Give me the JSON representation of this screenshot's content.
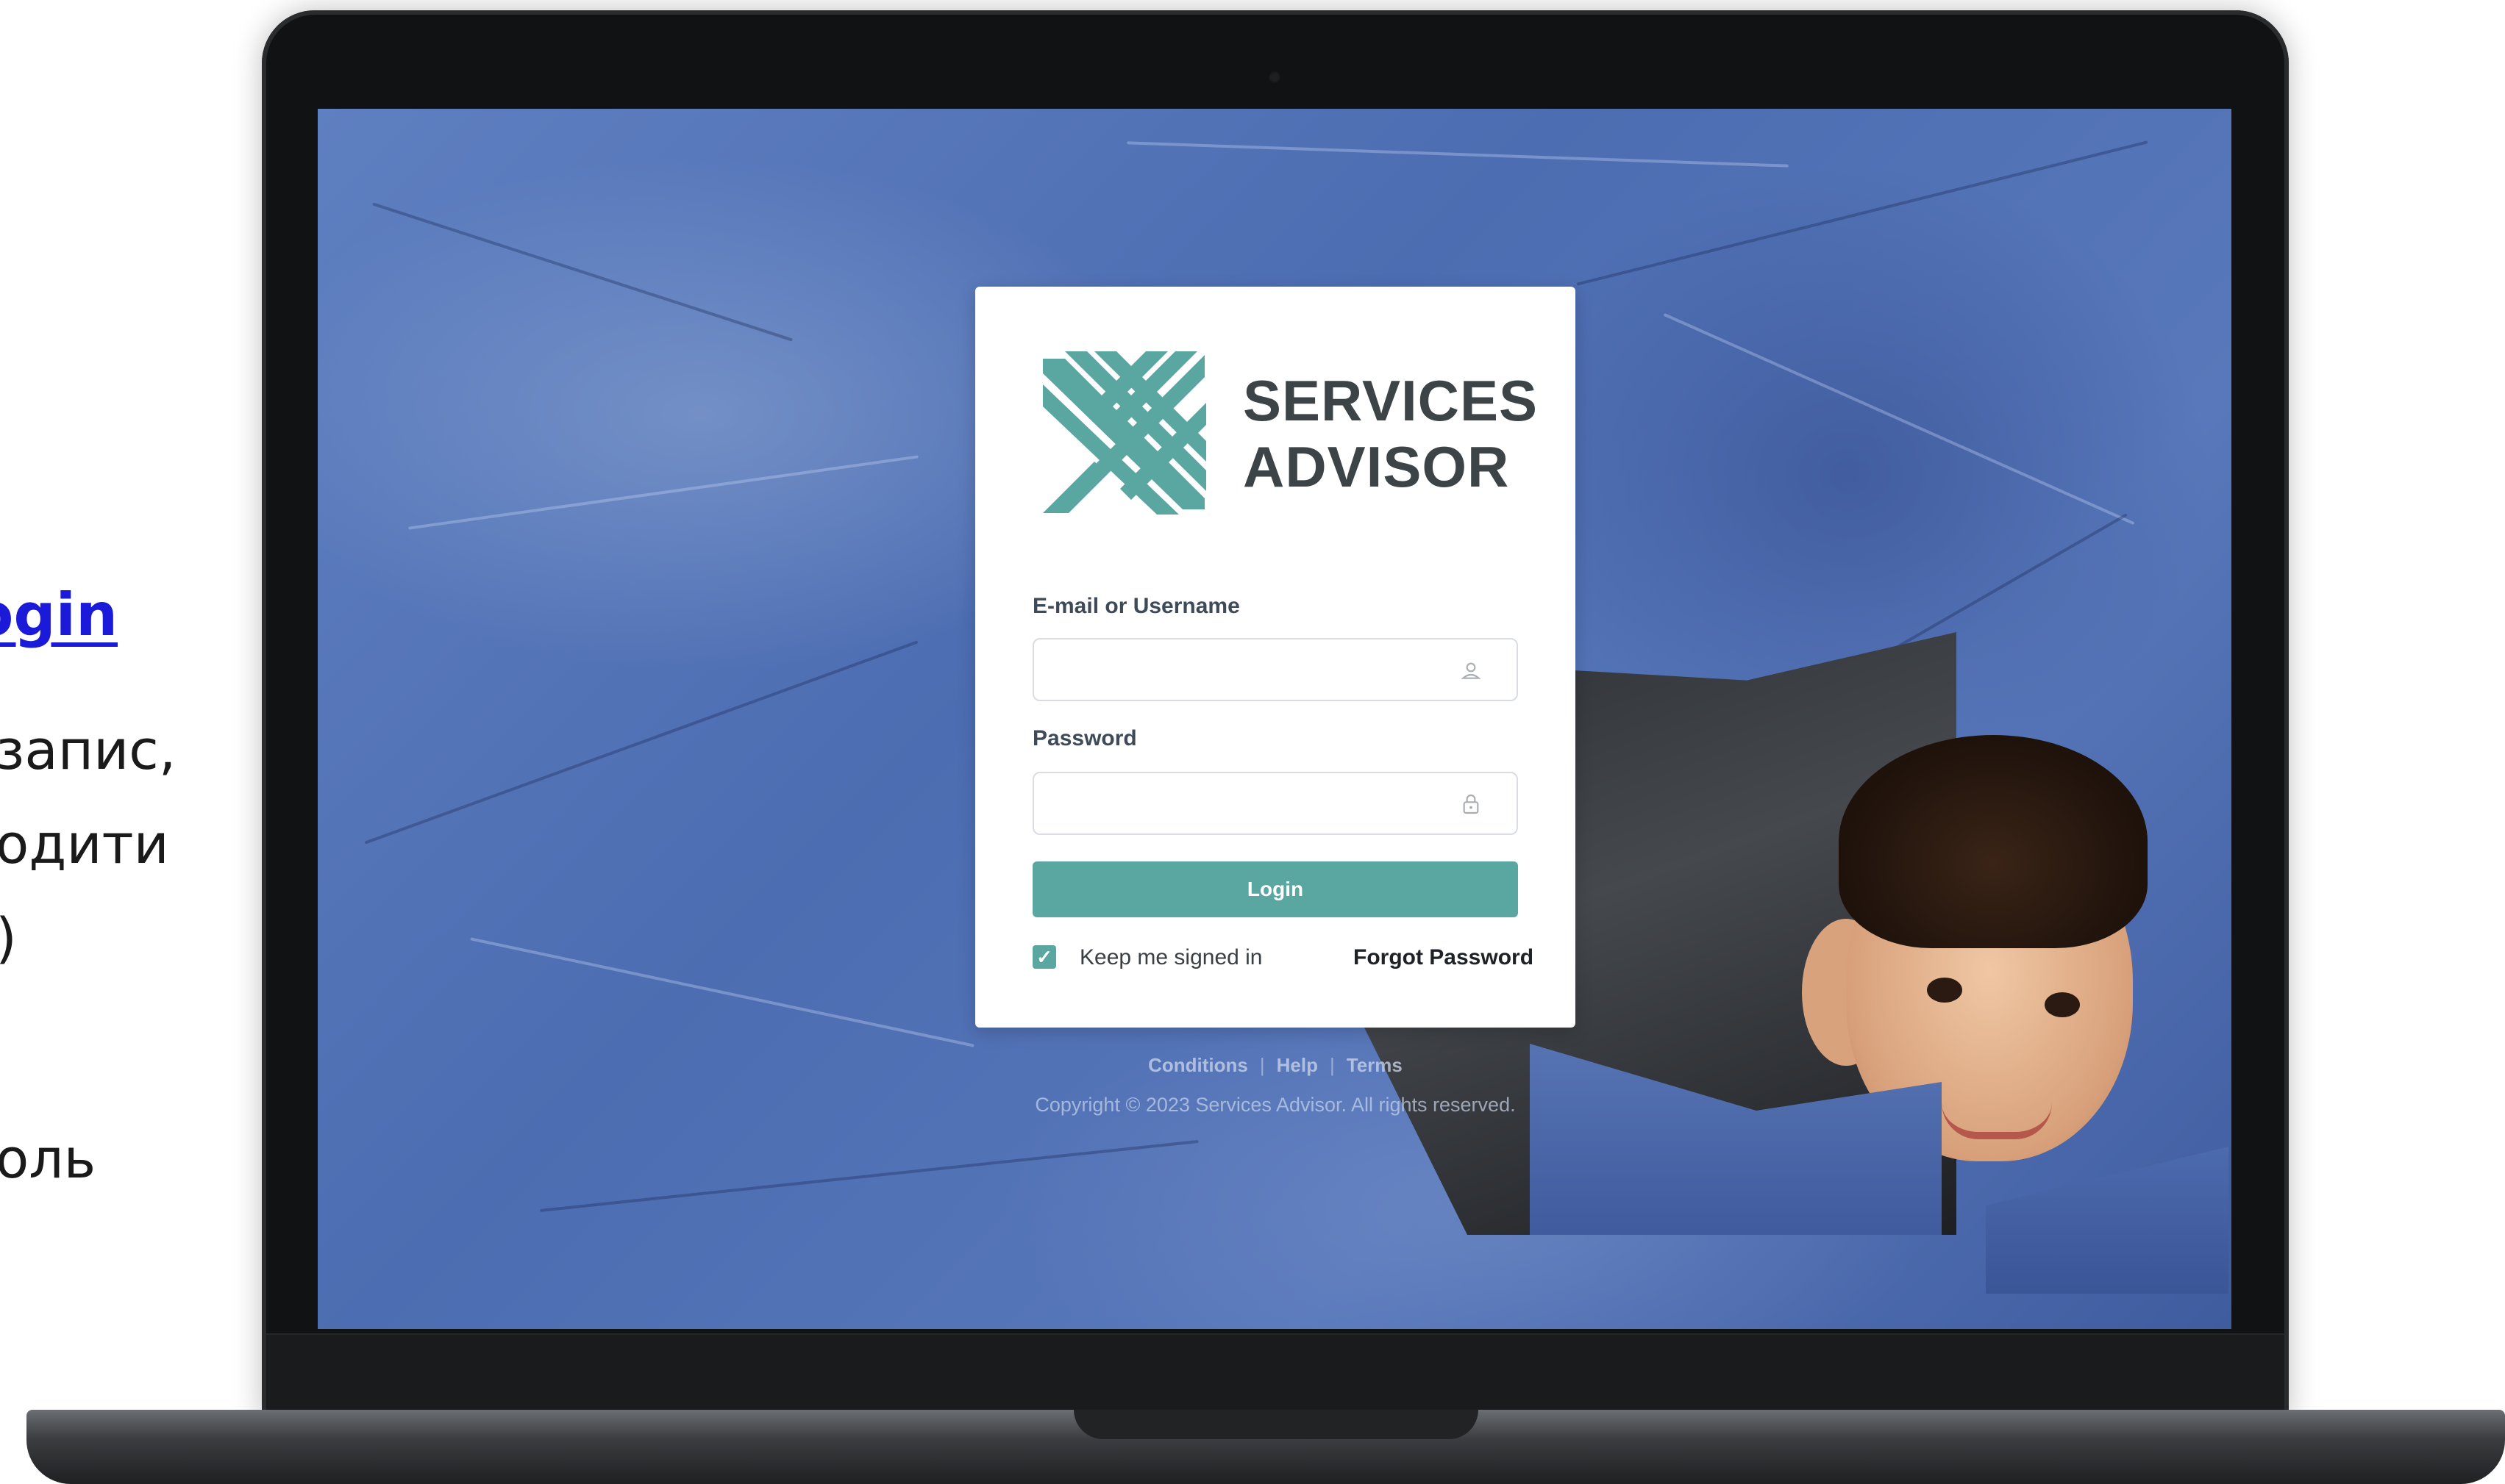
{
  "slide": {
    "link_text": "login",
    "lines": [
      "запис,",
      "одити",
      ")",
      "оль"
    ]
  },
  "login_page": {
    "brand_line1": "SERVICES",
    "brand_line2": "ADVISOR",
    "email_label": "E-mail or Username",
    "email_value": "",
    "email_icon": "user-icon",
    "password_label": "Password",
    "password_value": "",
    "password_icon": "lock-icon",
    "login_button": "Login",
    "keep_signed_in": "Keep me signed in",
    "keep_signed_in_checked": true,
    "forgot_password": "Forgot Password",
    "footer_links": [
      "Conditions",
      "Help",
      "Terms"
    ],
    "copyright": "Copyright © 2023 Services Advisor. All rights reserved."
  },
  "colors": {
    "accent": "#5aa6a1",
    "brand_text": "#3d4447",
    "link": "#1a1ad8"
  }
}
